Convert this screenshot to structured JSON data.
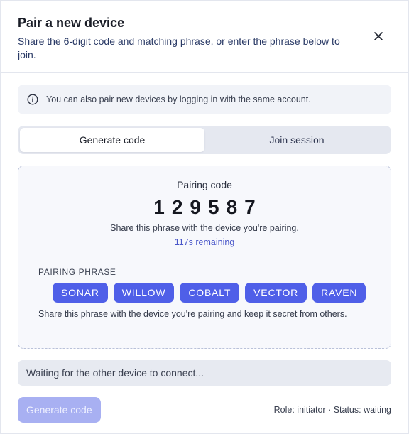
{
  "dialog": {
    "title": "Pair a new device",
    "subtitle": "Share the 6-digit code and matching phrase, or enter the phrase below to join."
  },
  "info": {
    "icon": "info-circle-icon",
    "text": "You can also pair new devices by logging in with the same account."
  },
  "tabs": [
    {
      "label": "Generate code",
      "active": true
    },
    {
      "label": "Join session",
      "active": false
    }
  ],
  "pairing": {
    "label": "Pairing code",
    "code": "129587",
    "share_text": "Share this phrase with the device you're pairing.",
    "remaining": "117s remaining",
    "phrase_label": "PAIRING PHRASE",
    "phrase_words": [
      "SONAR",
      "WILLOW",
      "COBALT",
      "VECTOR",
      "RAVEN"
    ],
    "phrase_note": "Share this phrase with the device you're pairing and keep it secret from others."
  },
  "status": {
    "waiting_text": "Waiting for the other device to connect...",
    "generate_button": "Generate code",
    "generate_disabled": true,
    "role_status": "Role: initiator · Status: waiting"
  },
  "colors": {
    "accent": "#4f5fe8",
    "accent_disabled": "#a8b0f2",
    "link": "#4a57c9"
  }
}
